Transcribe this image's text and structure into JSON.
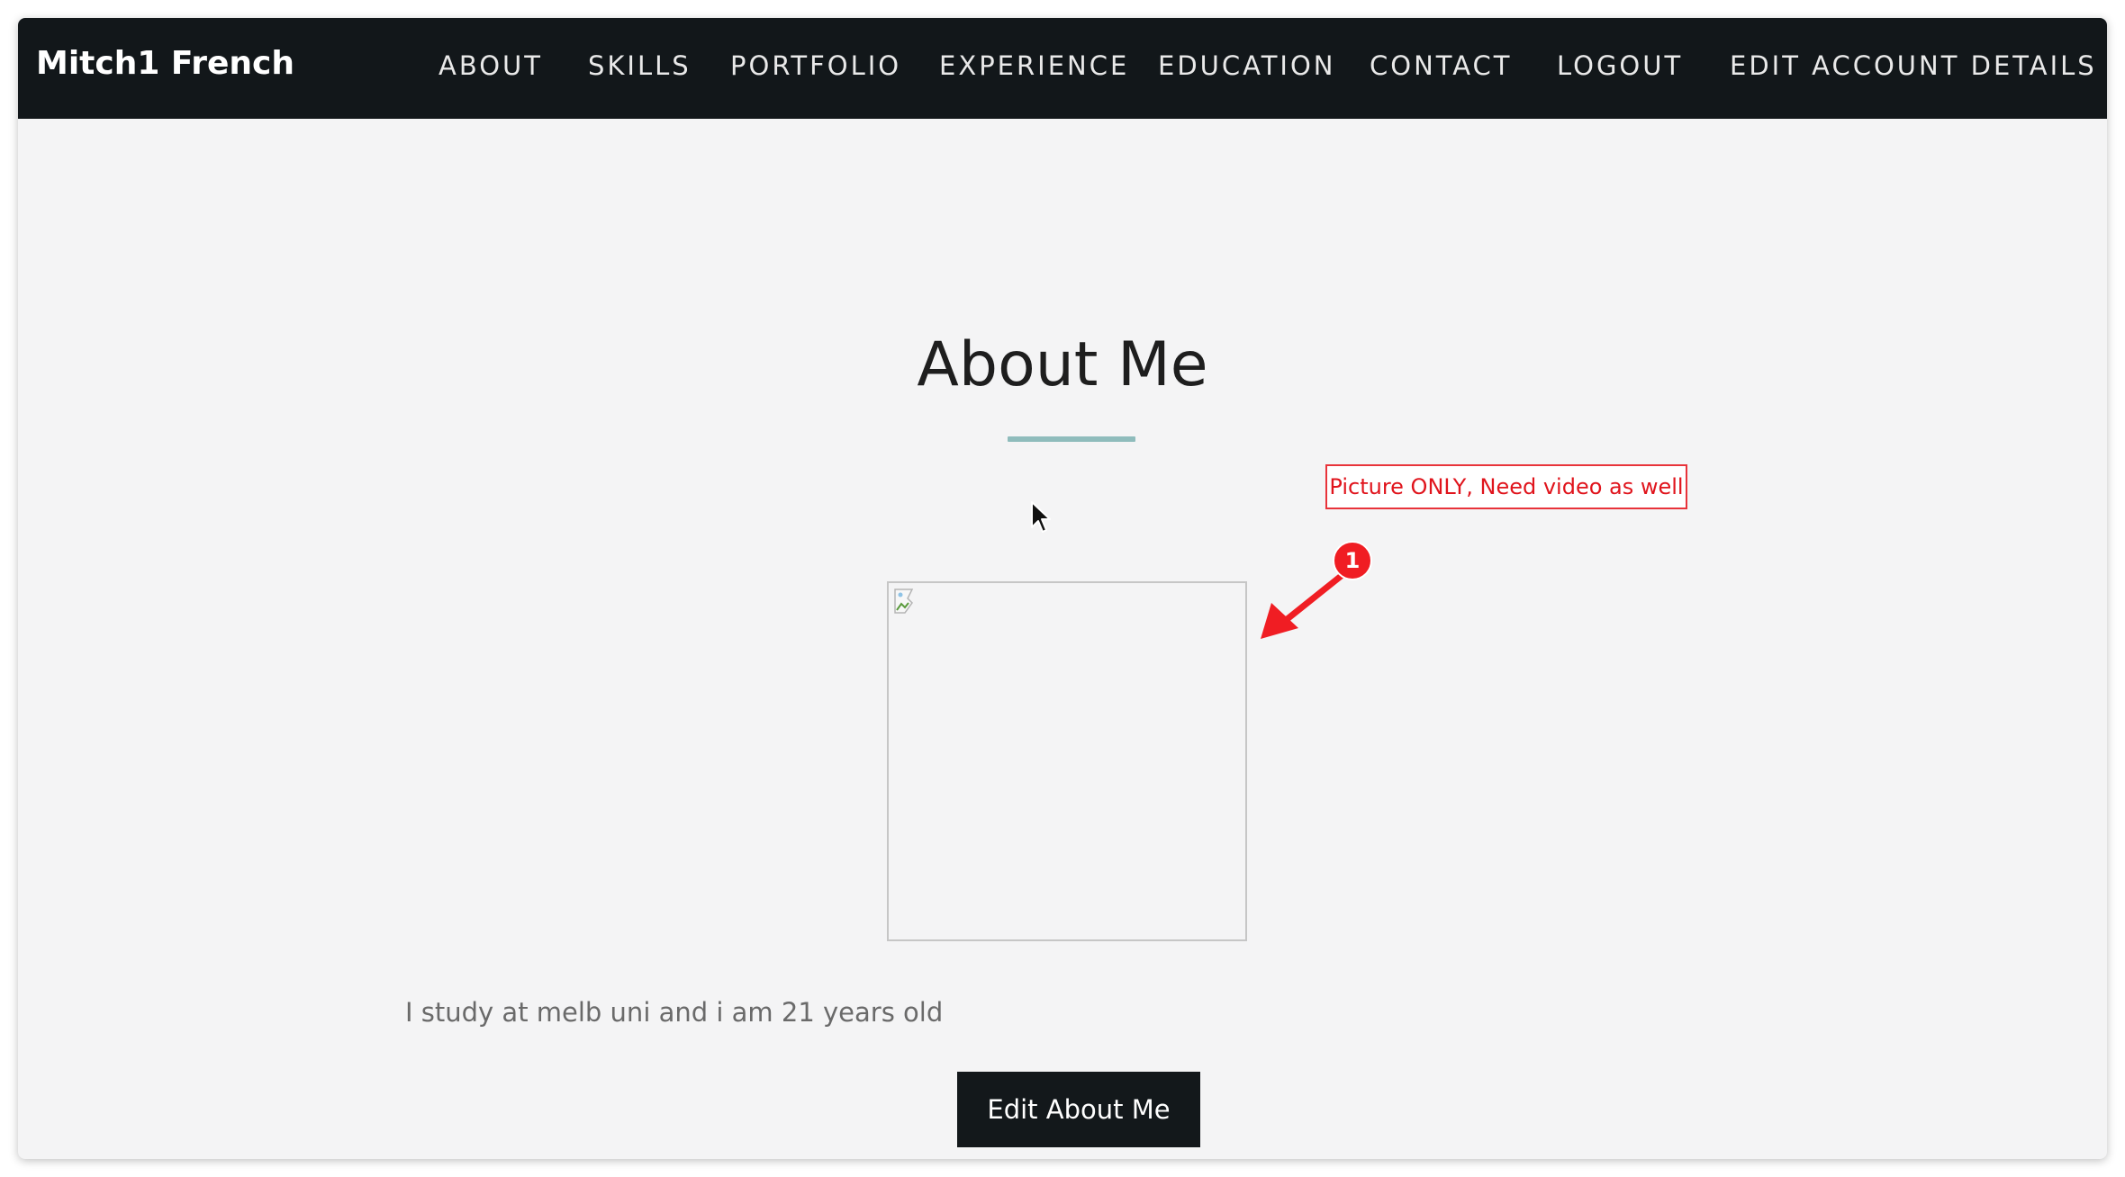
{
  "brand": {
    "name": "Mitch1 French"
  },
  "nav": {
    "items": [
      {
        "label": "ABOUT"
      },
      {
        "label": "SKILLS"
      },
      {
        "label": "PORTFOLIO"
      },
      {
        "label": "EXPERIENCE"
      },
      {
        "label": "EDUCATION"
      },
      {
        "label": "CONTACT"
      },
      {
        "label": "LOGOUT"
      },
      {
        "label": "EDIT ACCOUNT DETAILS"
      }
    ]
  },
  "about": {
    "title": "About Me",
    "description": "I study at melb uni and i am 21 years old",
    "edit_button_label": "Edit About Me",
    "image_icon": "broken-image-icon"
  },
  "annotation": {
    "note": "Picture ONLY, Need video as well",
    "badge_number": "1",
    "color": "#f01d23"
  },
  "colors": {
    "navbar": "#12171a",
    "page_background": "#f4f4f5",
    "accent_underline": "#8fbcbc",
    "button": "#13181b"
  }
}
